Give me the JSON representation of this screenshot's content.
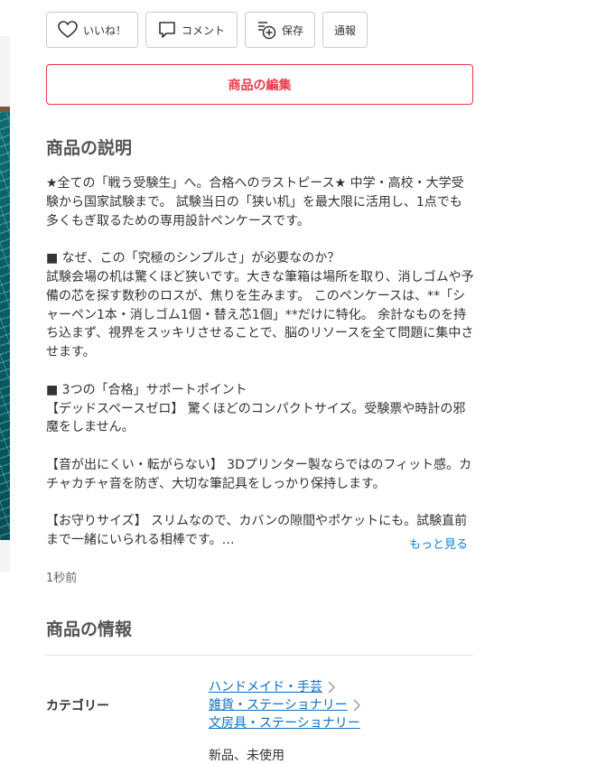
{
  "actions": {
    "like": "いいね！",
    "comment": "コメント",
    "save": "保存",
    "report": "通報"
  },
  "edit_button": "商品の編集",
  "description": {
    "title": "商品の説明",
    "paragraphs": [
      "★全ての「戦う受験生」へ。合格へのラストピース★ 中学・高校・大学受験から国家試験まで。 試験当日の「狭い机」を最大限に活用し、1点でも多くもぎ取るための専用設計ペンケースです。",
      "■ なぜ、この「究極のシンプルさ」が必要なのか？",
      "試験会場の机は驚くほど狭いです。大きな筆箱は場所を取り、消しゴムや予備の芯を探す数秒のロスが、焦りを生みます。 このペンケースは、**「シャーペン1本・消しゴム1個・替え芯1個」**だけに特化。 余計なものを持ち込まず、視界をスッキリさせることで、脳のリソースを全て問題に集中させます。",
      "■ 3つの「合格」サポートポイント",
      "【デッドスペースゼロ】 驚くほどのコンパクトサイズ。受験票や時計の邪魔をしません。",
      "【音が出にくい・転がらない】 3Dプリンター製ならではのフィット感。カチャカチャ音を防ぎ、大切な筆記具をしっかり保持します。",
      "【お守りサイズ】 スリムなので、カバンの隙間やポケットにも。試験直前まで一緒にいられる相棒です。…"
    ],
    "more_link": "もっと見る",
    "timestamp": "1秒前"
  },
  "info": {
    "title": "商品の情報",
    "category_label": "カテゴリー",
    "categories": [
      "ハンドメイド・手芸",
      "雑貨・ステーショナリー",
      "文房具・ステーショナリー"
    ],
    "condition_value": "新品、未使用"
  },
  "colors": {
    "accent": "#e8384a",
    "link": "#0a6fc2"
  }
}
